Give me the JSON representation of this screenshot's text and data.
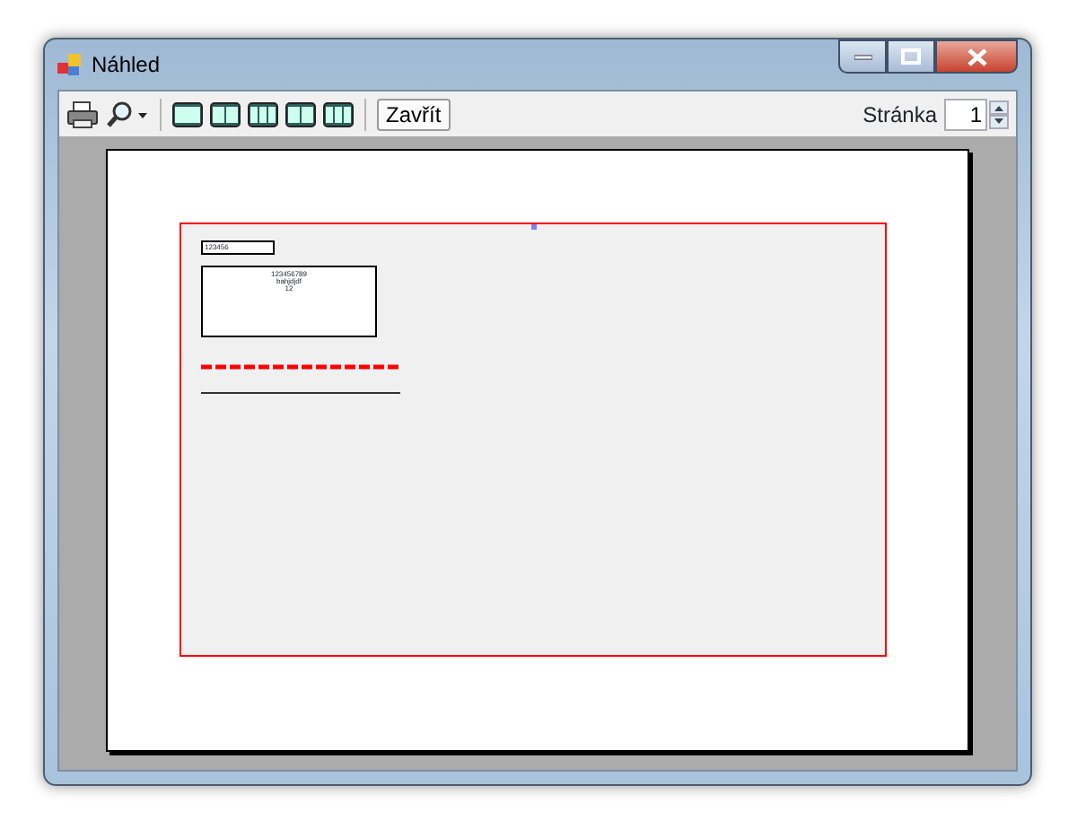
{
  "window": {
    "title": "Náhled"
  },
  "toolbar": {
    "tools": [
      {
        "kind": "print"
      },
      {
        "kind": "zoom"
      },
      {
        "kind": "one"
      },
      {
        "kind": "two"
      },
      {
        "kind": "three"
      },
      {
        "kind": "four"
      },
      {
        "kind": "six"
      }
    ],
    "close_button": "Zavřít",
    "page_label": "Stránka",
    "page_value": "1"
  },
  "preview": {
    "small_field": "123456",
    "box_lines": [
      "123456789",
      "bahjdjdf",
      "12"
    ]
  }
}
